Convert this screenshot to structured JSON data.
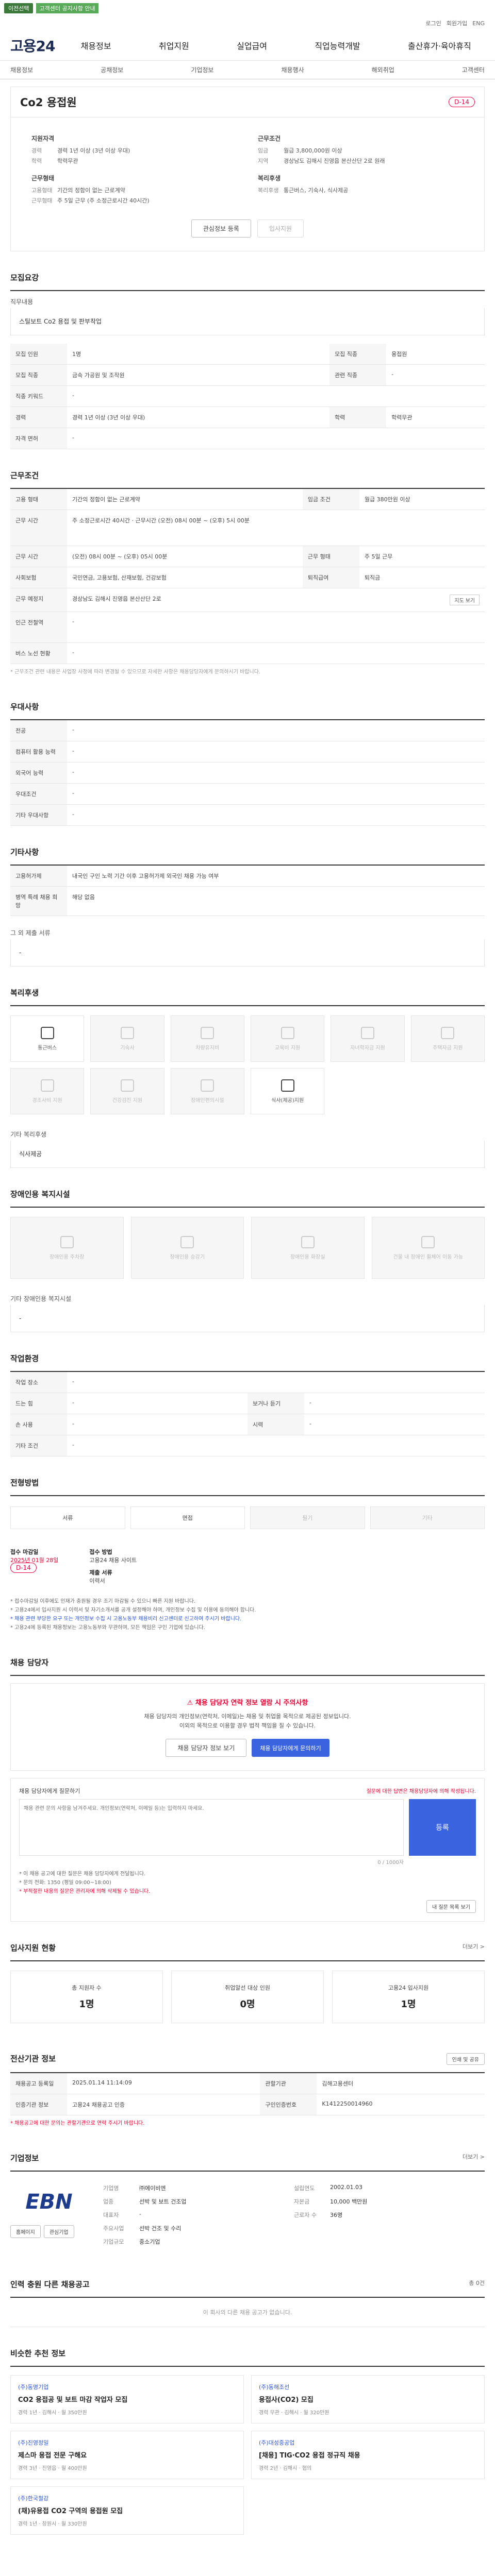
{
  "topbar": {
    "badge": "이전선택",
    "note": "고객센터 공지사항 안내"
  },
  "util": [
    "로그인",
    "회원가입",
    "ENG"
  ],
  "logo": "고용24",
  "gnb": [
    "채용정보",
    "취업지원",
    "실업급여",
    "직업능력개발",
    "출산휴가·육아휴직"
  ],
  "subnav": [
    "채용정보",
    "공채정보",
    "기업정보",
    "채용행사",
    "해외취업",
    "고객센터"
  ],
  "title": {
    "text": "Co2 용접원",
    "dday": "D-14"
  },
  "summary": {
    "left": {
      "h1": "지원자격",
      "rows": [
        {
          "k": "경력",
          "v": "경력 1년 이상 (3년 이상 우대)"
        },
        {
          "k": "학력",
          "v": "학력무관"
        }
      ],
      "h2": "근무형태",
      "rows2": [
        {
          "k": "고용형태",
          "v": "기간의 정함이 없는 근로계약"
        },
        {
          "k": "근무형태",
          "v": "주 5일 근무 (주 소정근로시간 40시간)"
        }
      ]
    },
    "right": {
      "h1": "근무조건",
      "rows": [
        {
          "k": "임금",
          "v": "월급 3,800,000원 이상"
        },
        {
          "k": "지역",
          "v": "경상남도 김해시 진영읍 본산산단 2로 원래"
        }
      ],
      "h2": "복리후생",
      "rows2": [
        {
          "k": "복리후생",
          "v": "통근버스, 기숙사, 식사제공"
        }
      ]
    },
    "btn_scrap": "관심정보 등록",
    "btn_apply": "입사지원"
  },
  "sec_job": {
    "title": "모집요강",
    "sub": "직무내용",
    "text": "스틸보트 Co2 용접 및 판부착업"
  },
  "job_table": [
    {
      "k": "모집 인원",
      "v": "1명",
      "k2": "모집 직종",
      "v2": "용접원"
    },
    {
      "k": "모집 직종",
      "v": "금속 가공원 및 조작원",
      "k2": "관련 직종",
      "v2": "-"
    },
    {
      "k": "직종 키워드",
      "v": "-",
      "k2": "",
      "v2": ""
    },
    {
      "k": "경력",
      "v": "경력 1년 이상 (3년 이상 우대)",
      "k2": "학력",
      "v2": "학력무관"
    },
    {
      "k": "자격 면허",
      "v": "-",
      "k2": "",
      "v2": ""
    }
  ],
  "sec_cond": {
    "title": "근무조건"
  },
  "cond_table": [
    {
      "k": "고용 형태",
      "v": "기간의 정함이 없는 근로계약",
      "k2": "임금 조건",
      "v2": "월급 380만원 이상"
    },
    {
      "k": "근무 시간",
      "v": "주 소정근로시간 40시간 · 근무시간 (오전) 08시 00분 ~ (오후) 5시 00분",
      "k2": "",
      "v2": ""
    },
    {
      "k": "근무 시간",
      "v": "(오전) 08시 00분 ~ (오후) 05시 00분",
      "k2": "근무 형태",
      "v2": "주 5일 근무"
    },
    {
      "k": "사회보험",
      "v": "국민연금, 고용보험, 산재보험, 건강보험",
      "k2": "퇴직급여",
      "v2": "퇴직금"
    },
    {
      "k": "근무 예정지",
      "v": "경상남도 김해시 진영읍 본산산단 2로",
      "k2": "",
      "v2": ""
    },
    {
      "k": "인근 전철역",
      "v": "-",
      "k2": "",
      "v2": ""
    },
    {
      "k": "버스 노선 현황",
      "v": "-",
      "k2": "",
      "v2": ""
    }
  ],
  "map_btn": "지도 보기",
  "cond_note": "* 근무조건 관련 내용은 사업장 사정에 따라 변경될 수 있으므로 자세한 사항은 채용담당자에게 문의하시기 바랍니다.",
  "sec_pref": {
    "title": "우대사항"
  },
  "pref_table": [
    {
      "k": "전공",
      "v": "-"
    },
    {
      "k": "컴퓨터 활용 능력",
      "v": "-"
    },
    {
      "k": "외국어 능력",
      "v": "-"
    },
    {
      "k": "우대조건",
      "v": "-"
    },
    {
      "k": "기타 우대사항",
      "v": "-"
    }
  ],
  "sec_etc": {
    "title": "기타사항"
  },
  "etc_table": [
    {
      "k": "고용허가제",
      "v": "내국인 구인 노력 기간 이후 고용허가제 외국인 채용 가능 여부"
    },
    {
      "k": "병역 특례 채용 희망",
      "v": "해당 없음"
    }
  ],
  "etc_sub": "그 외 제출 서류",
  "etc_sub_val": "-",
  "sec_welfare": {
    "title": "복리후생"
  },
  "welfare": [
    {
      "label": "통근버스",
      "on": true
    },
    {
      "label": "기숙사",
      "on": false
    },
    {
      "label": "차량유지비",
      "on": false
    },
    {
      "label": "교육비 지원",
      "on": false
    },
    {
      "label": "자녀학자금 지원",
      "on": false
    },
    {
      "label": "주택자금 지원",
      "on": false
    },
    {
      "label": "경조사비 지원",
      "on": false
    },
    {
      "label": "건강검진 지원",
      "on": false
    },
    {
      "label": "장애인편의시설",
      "on": false
    },
    {
      "label": "식사(제공)지원",
      "on": true
    }
  ],
  "welfare_etc": "기타 복리후생",
  "welfare_etc_val": "식사제공",
  "sec_disab": {
    "title": "장애인용 복지시설"
  },
  "disab": [
    {
      "label": "장애인용 주차장"
    },
    {
      "label": "장애인용 승강기"
    },
    {
      "label": "장애인용 화장실"
    },
    {
      "label": "건물 내 장애인 휠체어 이동 가능"
    }
  ],
  "disab_etc": "기타 장애인용 복지시설",
  "disab_etc_val": "-",
  "sec_env": {
    "title": "작업환경"
  },
  "env_table": [
    {
      "k": "작업 장소",
      "v": "-",
      "k2": "",
      "v2": ""
    },
    {
      "k": "드는 힘",
      "v": "-",
      "k2": "보거나 듣기",
      "v2": "-"
    },
    {
      "k": "손 사용",
      "v": "-",
      "k2": "시력",
      "v2": "-"
    },
    {
      "k": "기타 조건",
      "v": "-",
      "k2": "",
      "v2": ""
    }
  ],
  "sec_proc": {
    "title": "전형방법"
  },
  "proc": [
    {
      "label": "서류",
      "on": true
    },
    {
      "label": "면접",
      "on": true
    },
    {
      "label": "필기",
      "on": false
    },
    {
      "label": "기타",
      "on": false
    }
  ],
  "apply": {
    "k1": "접수 마감일",
    "v1": "2025년 01월 28일",
    "dday": "D-14",
    "k2": "접수 방법",
    "v2": "고용24 채용 사이트",
    "k3": "제출 서류",
    "v3": "이력서"
  },
  "notes": [
    "* 접수마감일 이후에도 인재가 충원될 경우 조기 마감될 수 있으니 빠른 지원 바랍니다.",
    "* 고용24에서 입사지원 시 이력서 및 자기소개서를 공개 설정해야 하며, 개인정보 수집 및 이용에 동의해야 합니다.",
    "* 채용 관련 부당한 요구 또는 개인정보 수집 시 고용노동부 채용비리 신고센터로 신고하여 주시기 바랍니다.",
    "* 고용24에 등록된 채용정보는 고용노동부와 무관하며, 모든 책임은 구인 기업에 있습니다."
  ],
  "sec_contact": {
    "title": "채용 담당자"
  },
  "contact": {
    "warn": "채용 담당자 연락 정보 열람 시 주의사항",
    "desc1": "채용 담당자의 개인정보(연락처, 이메일)는 채용 및 취업을 목적으로 제공된 정보입니다.",
    "desc2": "이외의 목적으로 이용할 경우 법적 책임을 질 수 있습니다.",
    "btn1": "채용 담당자 정보 보기",
    "btn2": "채용 담당자에게 문의하기"
  },
  "qa": {
    "head": "채용 담당자에게 질문하기",
    "hint": "질문에 대한 답변은 채용담당자에 의해 작성됩니다.",
    "placeholder": "채용 관련 문의 사항을 남겨주세요. 개인정보(연락처, 이메일 등)는 입력하지 마세요.",
    "count": "0 / 1000자",
    "submit": "등록",
    "link": "내 질문 목록 보기",
    "notes": [
      "* 이 채용 공고에 대한 질문은 채용 담당자에게 전달됩니다.",
      "* 문의 전화: 1350 (평일 09:00~18:00)",
      "* 부적절한 내용의 질문은 관리자에 의해 삭제될 수 있습니다."
    ]
  },
  "sec_stats": {
    "title": "입사지원 현황",
    "more": "더보기 >"
  },
  "stats": [
    {
      "label": "총 지원자 수",
      "value": "1명"
    },
    {
      "label": "취업알선 대상 인원",
      "value": "0명"
    },
    {
      "label": "고용24 입사지원",
      "value": "1명"
    }
  ],
  "sec_org": {
    "title": "전산기관 정보",
    "btn": "인쇄 및 공유"
  },
  "org_table": [
    {
      "k": "채용공고 등록일",
      "v": "2025.01.14 11:14:09",
      "k2": "관할기관",
      "v2": "김해고용센터"
    },
    {
      "k": "인증기관 정보",
      "v": "고용24 채용공고 인증",
      "k2": "구인인증번호",
      "v2": "K1412250014960"
    }
  ],
  "org_note": "* 채용공고에 대한 문의는 관할기관으로 연락 주시기 바랍니다.",
  "sec_company": {
    "title": "기업정보",
    "more": "더보기 >"
  },
  "company": {
    "logo": "EBN",
    "rows": [
      {
        "k": "기업명",
        "v": "㈜에이비엔",
        "k2": "설립연도",
        "v2": "2002.01.03"
      },
      {
        "k": "업종",
        "v": "선박 및 보트 건조업",
        "k2": "자본금",
        "v2": "10,000 백만원"
      },
      {
        "k": "대표자",
        "v": "-",
        "k2": "근로자 수",
        "v2": "36명"
      },
      {
        "k": "주요사업",
        "v": "선박 건조 및 수리",
        "k2": "",
        "v2": ""
      },
      {
        "k": "기업규모",
        "v": "중소기업",
        "k2": "",
        "v2": ""
      }
    ],
    "btn1": "홈페이지",
    "btn2": "관심기업"
  },
  "sec_other": {
    "title": "인력 충원 다른 채용공고",
    "right": "총 0건",
    "empty": "이 회사의 다른 채용 공고가 없습니다."
  },
  "sec_recommend": {
    "title": "비슷한 추천 정보"
  },
  "jobs": [
    {
      "co": "(주)동명기업",
      "title": "CO2 용접공 및 보트 마감 작업자 모집",
      "meta": "경력 1년 · 김해시 · 월 350만원"
    },
    {
      "co": "(주)동해조선",
      "title": "용접사(CO2) 모집",
      "meta": "경력 무관 · 김해시 · 월 320만원"
    },
    {
      "co": "(주)진영정밀",
      "title": "제스마 용접 전문 구해요",
      "meta": "경력 3년 · 진영읍 · 월 400만원"
    },
    {
      "co": "(주)대성중공업",
      "title": "[채용] TIG·CO2 용접 정규직 채용",
      "meta": "경력 2년 · 김해시 · 협의"
    },
    {
      "co": "(주)한국철강",
      "title": "(채)유용접 CO2 구역의 용접원 모집",
      "meta": "경력 1년 · 창원시 · 월 330만원"
    }
  ]
}
